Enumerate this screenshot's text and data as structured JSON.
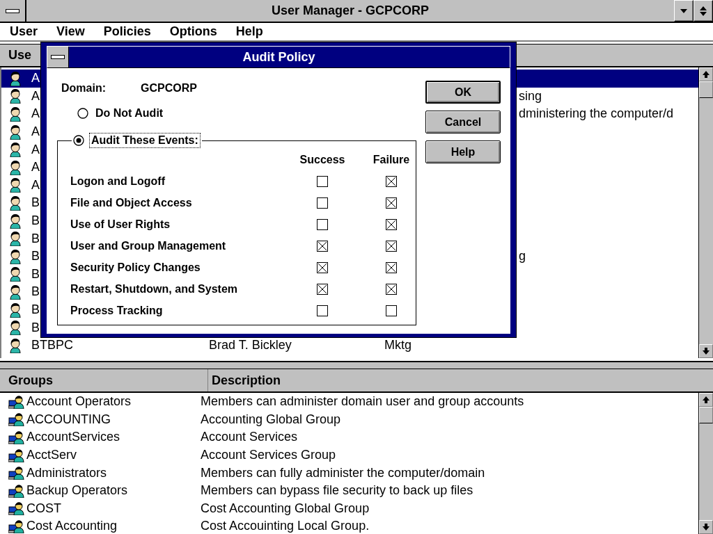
{
  "window": {
    "title": "User Manager - GCPCORP"
  },
  "menu": [
    "User",
    "View",
    "Policies",
    "Options",
    "Help"
  ],
  "users": {
    "header": "Use",
    "rows": [
      {
        "kind": "covered",
        "username": "A",
        "selected": true
      },
      {
        "kind": "covered",
        "username": "A",
        "description": "sing",
        "selected": false
      },
      {
        "kind": "covered",
        "username": "A",
        "description": "dministering the computer/d",
        "selected": false
      },
      {
        "kind": "covered",
        "username": "A",
        "selected": false
      },
      {
        "kind": "covered",
        "username": "A",
        "selected": false
      },
      {
        "kind": "covered",
        "username": "A",
        "selected": false
      },
      {
        "kind": "covered",
        "username": "A",
        "selected": false
      },
      {
        "kind": "covered",
        "username": "B",
        "selected": false
      },
      {
        "kind": "covered",
        "username": "B",
        "selected": false
      },
      {
        "kind": "covered",
        "username": "B",
        "selected": false
      },
      {
        "kind": "covered",
        "username": "B",
        "description": "g",
        "selected": false
      },
      {
        "kind": "covered",
        "username": "B",
        "selected": false
      },
      {
        "kind": "covered",
        "username": "B",
        "selected": false
      },
      {
        "kind": "covered",
        "username": "B",
        "selected": false
      },
      {
        "kind": "covered",
        "username": "B",
        "selected": false
      },
      {
        "kind": "full",
        "username": "BTBPC",
        "full_name": "Brad T. Bickley",
        "description": "Mktg",
        "selected": false
      }
    ]
  },
  "groups": {
    "columns": [
      "Groups",
      "Description"
    ],
    "rows": [
      {
        "name": "Account Operators",
        "description": "Members can administer domain user and group accounts"
      },
      {
        "name": "ACCOUNTING",
        "description": "Accounting Global Group"
      },
      {
        "name": "AccountServices",
        "description": "Account Services"
      },
      {
        "name": "AcctServ",
        "description": "Account Services Group"
      },
      {
        "name": "Administrators",
        "description": "Members can fully administer the computer/domain"
      },
      {
        "name": "Backup Operators",
        "description": "Members can bypass file security to back up files"
      },
      {
        "name": "COST",
        "description": "Cost Accounting Global Group"
      },
      {
        "name": "Cost Accounting",
        "description": "Cost Accouinting Local Group."
      }
    ]
  },
  "dialog": {
    "title": "Audit Policy",
    "domain_label": "Domain:",
    "domain": "GCPCORP",
    "options": [
      {
        "label": "Do Not Audit",
        "selected": false
      },
      {
        "label": "Audit These Events:",
        "selected": true
      }
    ],
    "columns": [
      "Success",
      "Failure"
    ],
    "events": [
      {
        "label": "Logon and Logoff",
        "success": false,
        "failure": true
      },
      {
        "label": "File and Object Access",
        "success": false,
        "failure": true
      },
      {
        "label": "Use of User Rights",
        "success": false,
        "failure": true
      },
      {
        "label": "User and Group Management",
        "success": true,
        "failure": true
      },
      {
        "label": "Security Policy Changes",
        "success": true,
        "failure": true
      },
      {
        "label": "Restart, Shutdown, and System",
        "success": true,
        "failure": true
      },
      {
        "label": "Process Tracking",
        "success": false,
        "failure": false
      }
    ],
    "buttons": [
      {
        "label": "OK",
        "default": true
      },
      {
        "label": "Cancel",
        "default": false
      },
      {
        "label": "Help",
        "default": false
      }
    ]
  }
}
